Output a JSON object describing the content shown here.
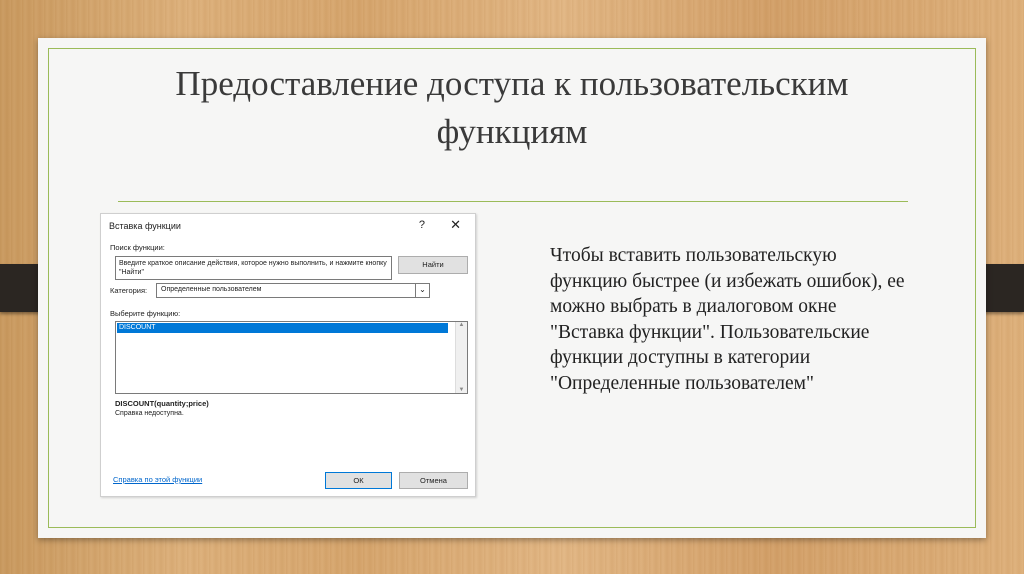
{
  "slide": {
    "title": "Предоставление доступа к пользовательским функциям",
    "body": "Чтобы вставить пользовательскую функцию быстрее (и избежать ошибок), ее можно выбрать в диалоговом окне \"Вставка функции\". Пользовательские функции доступны в категории \"Определенные пользователем\"",
    "accent_color": "#9bbb59"
  },
  "dialog": {
    "title": "Вставка функции",
    "help_label": "?",
    "close_label": "✕",
    "search_label": "Поиск функции:",
    "search_placeholder": "Введите краткое описание действия, которое нужно выполнить, и нажмите кнопку \"Найти\"",
    "find_button": "Найти",
    "category_label": "Категория:",
    "category_value": "Определенные пользователем",
    "select_label": "Выберите функцию:",
    "functions": [
      "DISCOUNT"
    ],
    "signature": "DISCOUNT(quantity;price)",
    "help_text": "Справка недоступна.",
    "help_link": "Справка по этой функции",
    "ok_button": "ОК",
    "cancel_button": "Отмена"
  }
}
